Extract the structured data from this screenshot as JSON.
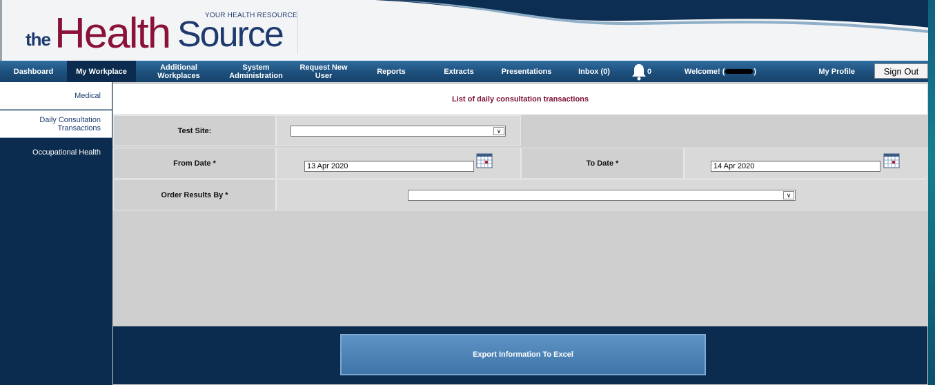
{
  "brand": {
    "tagline": "YOUR HEALTH RESOURCE",
    "the": "the",
    "health": "Health",
    "source": "Source",
    "colors": {
      "navy": "#1e3a6e",
      "maroon": "#8a1138",
      "sidebar": "#0b2c4e"
    }
  },
  "nav": {
    "items": [
      {
        "label": "Dashboard"
      },
      {
        "label": "My Workplace",
        "active": true
      },
      {
        "label": "Additional Workplaces"
      },
      {
        "label": "System Administration"
      },
      {
        "label": "Request New User"
      },
      {
        "label": "Reports"
      },
      {
        "label": "Extracts"
      },
      {
        "label": "Presentations"
      },
      {
        "label": "Inbox (0)"
      }
    ],
    "bell_icon": "bell-icon",
    "notification_count": "0",
    "welcome_prefix": "Welcome! (",
    "welcome_suffix": ")",
    "my_profile": "My Profile",
    "sign_out": "Sign Out"
  },
  "sidebar": {
    "items": [
      {
        "label": "Medical"
      },
      {
        "label": "Daily Consultation Transactions",
        "active": true
      },
      {
        "label": "Occupational Health"
      }
    ]
  },
  "form": {
    "title": "List of daily consultation transactions",
    "test_site_label": "Test Site:",
    "test_site_value": "",
    "from_date_label": "From Date *",
    "from_date_value": "13 Apr 2020",
    "to_date_label": "To Date *",
    "to_date_value": "14 Apr 2020",
    "order_by_label": "Order Results By *",
    "order_by_value": "",
    "export_button": "Export Information To Excel"
  }
}
